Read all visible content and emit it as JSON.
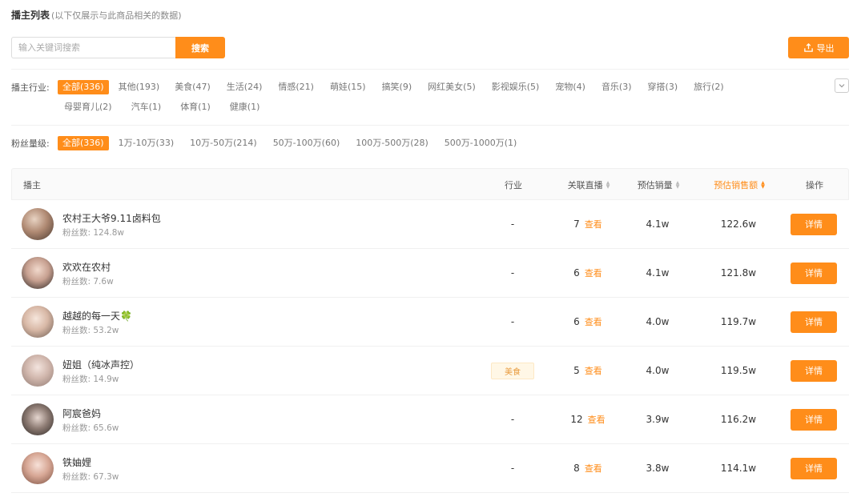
{
  "header": {
    "title": "播主列表",
    "subtitle": "(以下仅展示与此商品相关的数据)"
  },
  "search": {
    "placeholder": "输入关键词搜索",
    "button": "搜索"
  },
  "export": {
    "label": "导出",
    "icon": "upload-icon"
  },
  "industry_filter": {
    "label": "播主行业:",
    "options": [
      "全部(336)",
      "其他(193)",
      "美食(47)",
      "生活(24)",
      "情感(21)",
      "萌娃(15)",
      "搞笑(9)",
      "网红美女(5)",
      "影视娱乐(5)",
      "宠物(4)",
      "音乐(3)",
      "穿搭(3)",
      "旅行(2)",
      "母婴育儿(2)",
      "汽车(1)",
      "体育(1)",
      "健康(1)"
    ],
    "selected": "全部(336)"
  },
  "fans_filter": {
    "label": "粉丝量级:",
    "options": [
      "全部(336)",
      "1万-10万(33)",
      "10万-50万(214)",
      "50万-100万(60)",
      "100万-500万(28)",
      "500万-1000万(1)"
    ],
    "selected": "全部(336)"
  },
  "table": {
    "columns": [
      "播主",
      "行业",
      "关联直播",
      "预估销量",
      "预估销售额",
      "操作"
    ],
    "sorted_column": "预估销售额",
    "view_label": "查看",
    "detail_label": "详情",
    "rows": [
      {
        "name": "农村王大爷9.11卤料包",
        "fans": "粉丝数: 124.8w",
        "industry": "-",
        "lives": "7",
        "sales": "4.1w",
        "revenue": "122.6w"
      },
      {
        "name": "欢欢在农村",
        "fans": "粉丝数: 7.6w",
        "industry": "-",
        "lives": "6",
        "sales": "4.1w",
        "revenue": "121.8w"
      },
      {
        "name": "越越的每一天🍀",
        "fans": "粉丝数: 53.2w",
        "industry": "-",
        "lives": "6",
        "sales": "4.0w",
        "revenue": "119.7w"
      },
      {
        "name": "妞姐（纯冰声控）",
        "fans": "粉丝数: 14.9w",
        "industry": "美食",
        "lives": "5",
        "sales": "4.0w",
        "revenue": "119.5w"
      },
      {
        "name": "阿宸爸妈",
        "fans": "粉丝数: 65.6w",
        "industry": "-",
        "lives": "12",
        "sales": "3.9w",
        "revenue": "116.2w"
      },
      {
        "name": "铁妯娌",
        "fans": "粉丝数: 67.3w",
        "industry": "-",
        "lives": "8",
        "sales": "3.8w",
        "revenue": "114.1w"
      }
    ]
  },
  "colors": {
    "accent": "#ff8d1a",
    "tag_bg": "#fff7e6"
  }
}
